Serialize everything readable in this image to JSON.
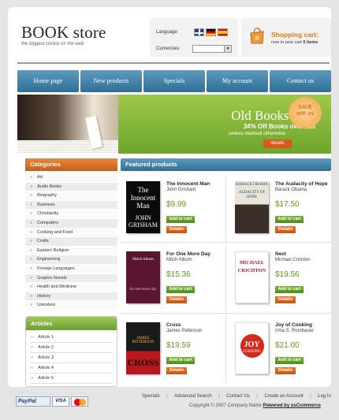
{
  "header": {
    "title": "BOOK store",
    "tagline": "the biggest choice on the web"
  },
  "locale": {
    "language_label": "Language:",
    "languages": [
      "English",
      "Deutsch",
      "Español"
    ],
    "currencies_label": "Currencies:",
    "currency_selected": ""
  },
  "cart": {
    "title": "Shopping cart:",
    "text_before": "now in your cart",
    "count": "0",
    "text_after": "items"
  },
  "nav": {
    "items": [
      "Home page",
      "New products",
      "Specials",
      "My account",
      "Contact us"
    ]
  },
  "banner": {
    "title": "Old Books Sale",
    "offer": "34% Off Books over $25",
    "note": "unless marked otherwise",
    "details": "details",
    "badge_line1": "SAVE",
    "badge_line2": "with us"
  },
  "categories": {
    "title": "Categories",
    "items": [
      "Art",
      "Audio Books",
      "Biography",
      "Business",
      "Christianity",
      "Computers",
      "Cooking and Food",
      "Crafts",
      "Eastern Religion",
      "Engineering",
      "Foreign Languages",
      "Graphic Novels",
      "Health and Medicine",
      "History",
      "Literature"
    ]
  },
  "articles": {
    "title": "Articles",
    "items": [
      "Article 1",
      "Article 2",
      "Article 3",
      "Article 4",
      "Article 5"
    ]
  },
  "featured": {
    "title": "Featured products",
    "add_label": "Add to cart",
    "details_label": "Details",
    "products": [
      {
        "title": "The Innocent Man",
        "author": "John Grisham",
        "price": "$9.99",
        "cover_top": "The Innocent Man",
        "cover_bottom": "JOHN GRISHAM",
        "cover_color": "#0b0b0b"
      },
      {
        "title": "The Audacity of Hope",
        "author": "Barack Obama",
        "price": "$17.50",
        "cover_top": "BARACK OBAMA",
        "cover_bottom": "AUDACITY OF HOPE",
        "cover_color": "#e9e4d6"
      },
      {
        "title": "For One More Day",
        "author": "Mitch Albom",
        "price": "$15.36",
        "cover_top": "Mitch Albom",
        "cover_bottom": "for one more day",
        "cover_color": "#5a1530"
      },
      {
        "title": "Next",
        "author": "Michael Crichton",
        "price": "$19.56",
        "cover_top": "MICHAEL",
        "cover_bottom": "CRICHTON",
        "cover_color": "#ffffff"
      },
      {
        "title": "Cross",
        "author": "James Patterson",
        "price": "$19.59",
        "cover_top": "JAMES PATTERSON",
        "cover_bottom": "CROSS",
        "cover_color": "#1a1a1a"
      },
      {
        "title": "Joy of Cooking",
        "author": "Irma S. Rombauer",
        "price": "$21.00",
        "cover_top": "JOY",
        "cover_bottom": "COOKING",
        "cover_color": "#ffffff"
      }
    ]
  },
  "footer": {
    "links": [
      "Specials",
      "Advanced Search",
      "Contact Us",
      "Create an Account",
      "Log In"
    ],
    "copyright_prefix": "Copyright © 2007 Company Name",
    "powered": "Powered by osCommerce",
    "payment": [
      "PayPal",
      "VISA",
      "MasterCard"
    ]
  },
  "colors": {
    "nav_blue": "#2f6e95",
    "orange": "#d75a1a",
    "green": "#6da52c",
    "price_green": "#5f9a1a",
    "cart_orange": "#e07b10"
  }
}
